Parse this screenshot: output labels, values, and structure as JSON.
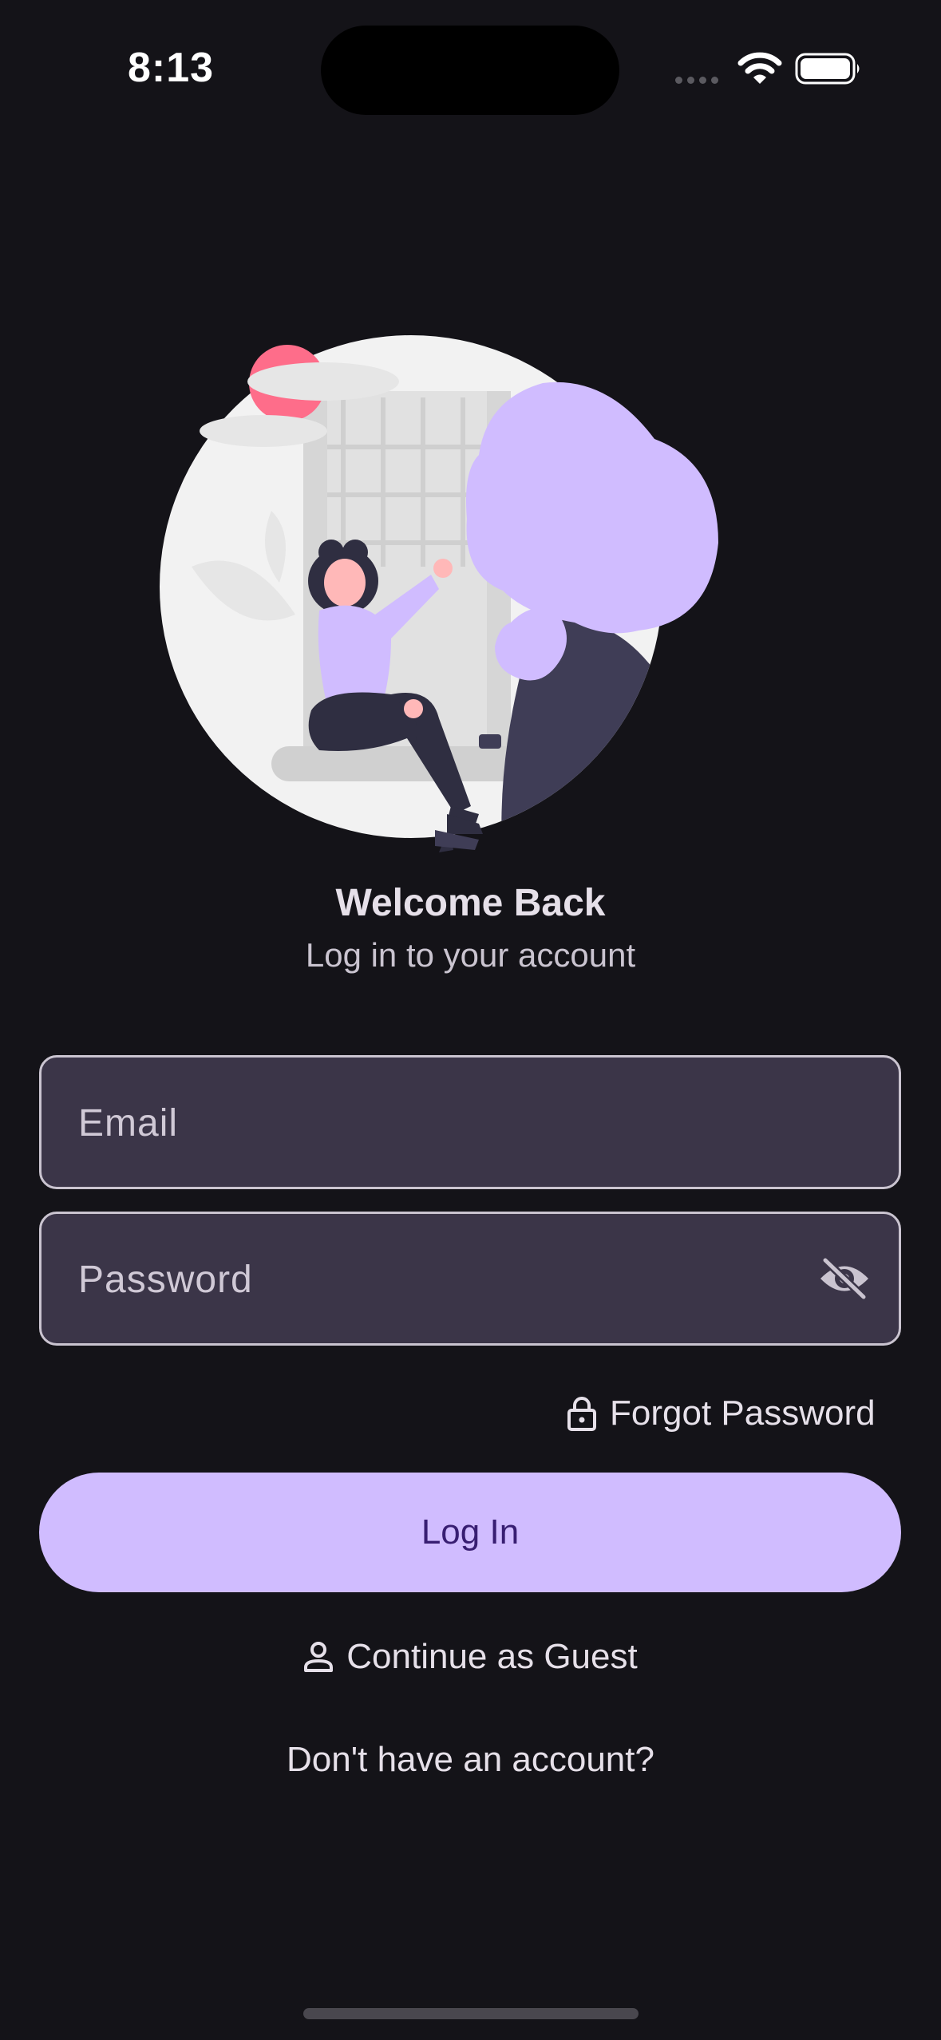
{
  "status_bar": {
    "time": "8:13"
  },
  "illustration": {
    "icon": "person-at-window-illustration",
    "colors": {
      "accent": "#d0bcff",
      "sun": "#fe6d8a",
      "backdrop": "#f2f2f2"
    }
  },
  "header": {
    "title": "Welcome Back",
    "subtitle": "Log in to your account"
  },
  "form": {
    "email_placeholder": "Email",
    "email_value": "",
    "password_placeholder": "Password",
    "password_value": "",
    "password_visibility_icon": "eye-off-icon",
    "forgot_password_label": "Forgot Password",
    "forgot_password_icon": "lock-icon"
  },
  "actions": {
    "login_label": "Log In",
    "guest_label": "Continue as Guest",
    "guest_icon": "person-icon",
    "signup_prompt": "Don't have an account?"
  },
  "theme": {
    "background": "#141318",
    "field_fill": "#3b3548",
    "field_border": "#cac4d0",
    "primary": "#d0bcff",
    "on_primary": "#381e72",
    "text": "#e6e0e9"
  }
}
